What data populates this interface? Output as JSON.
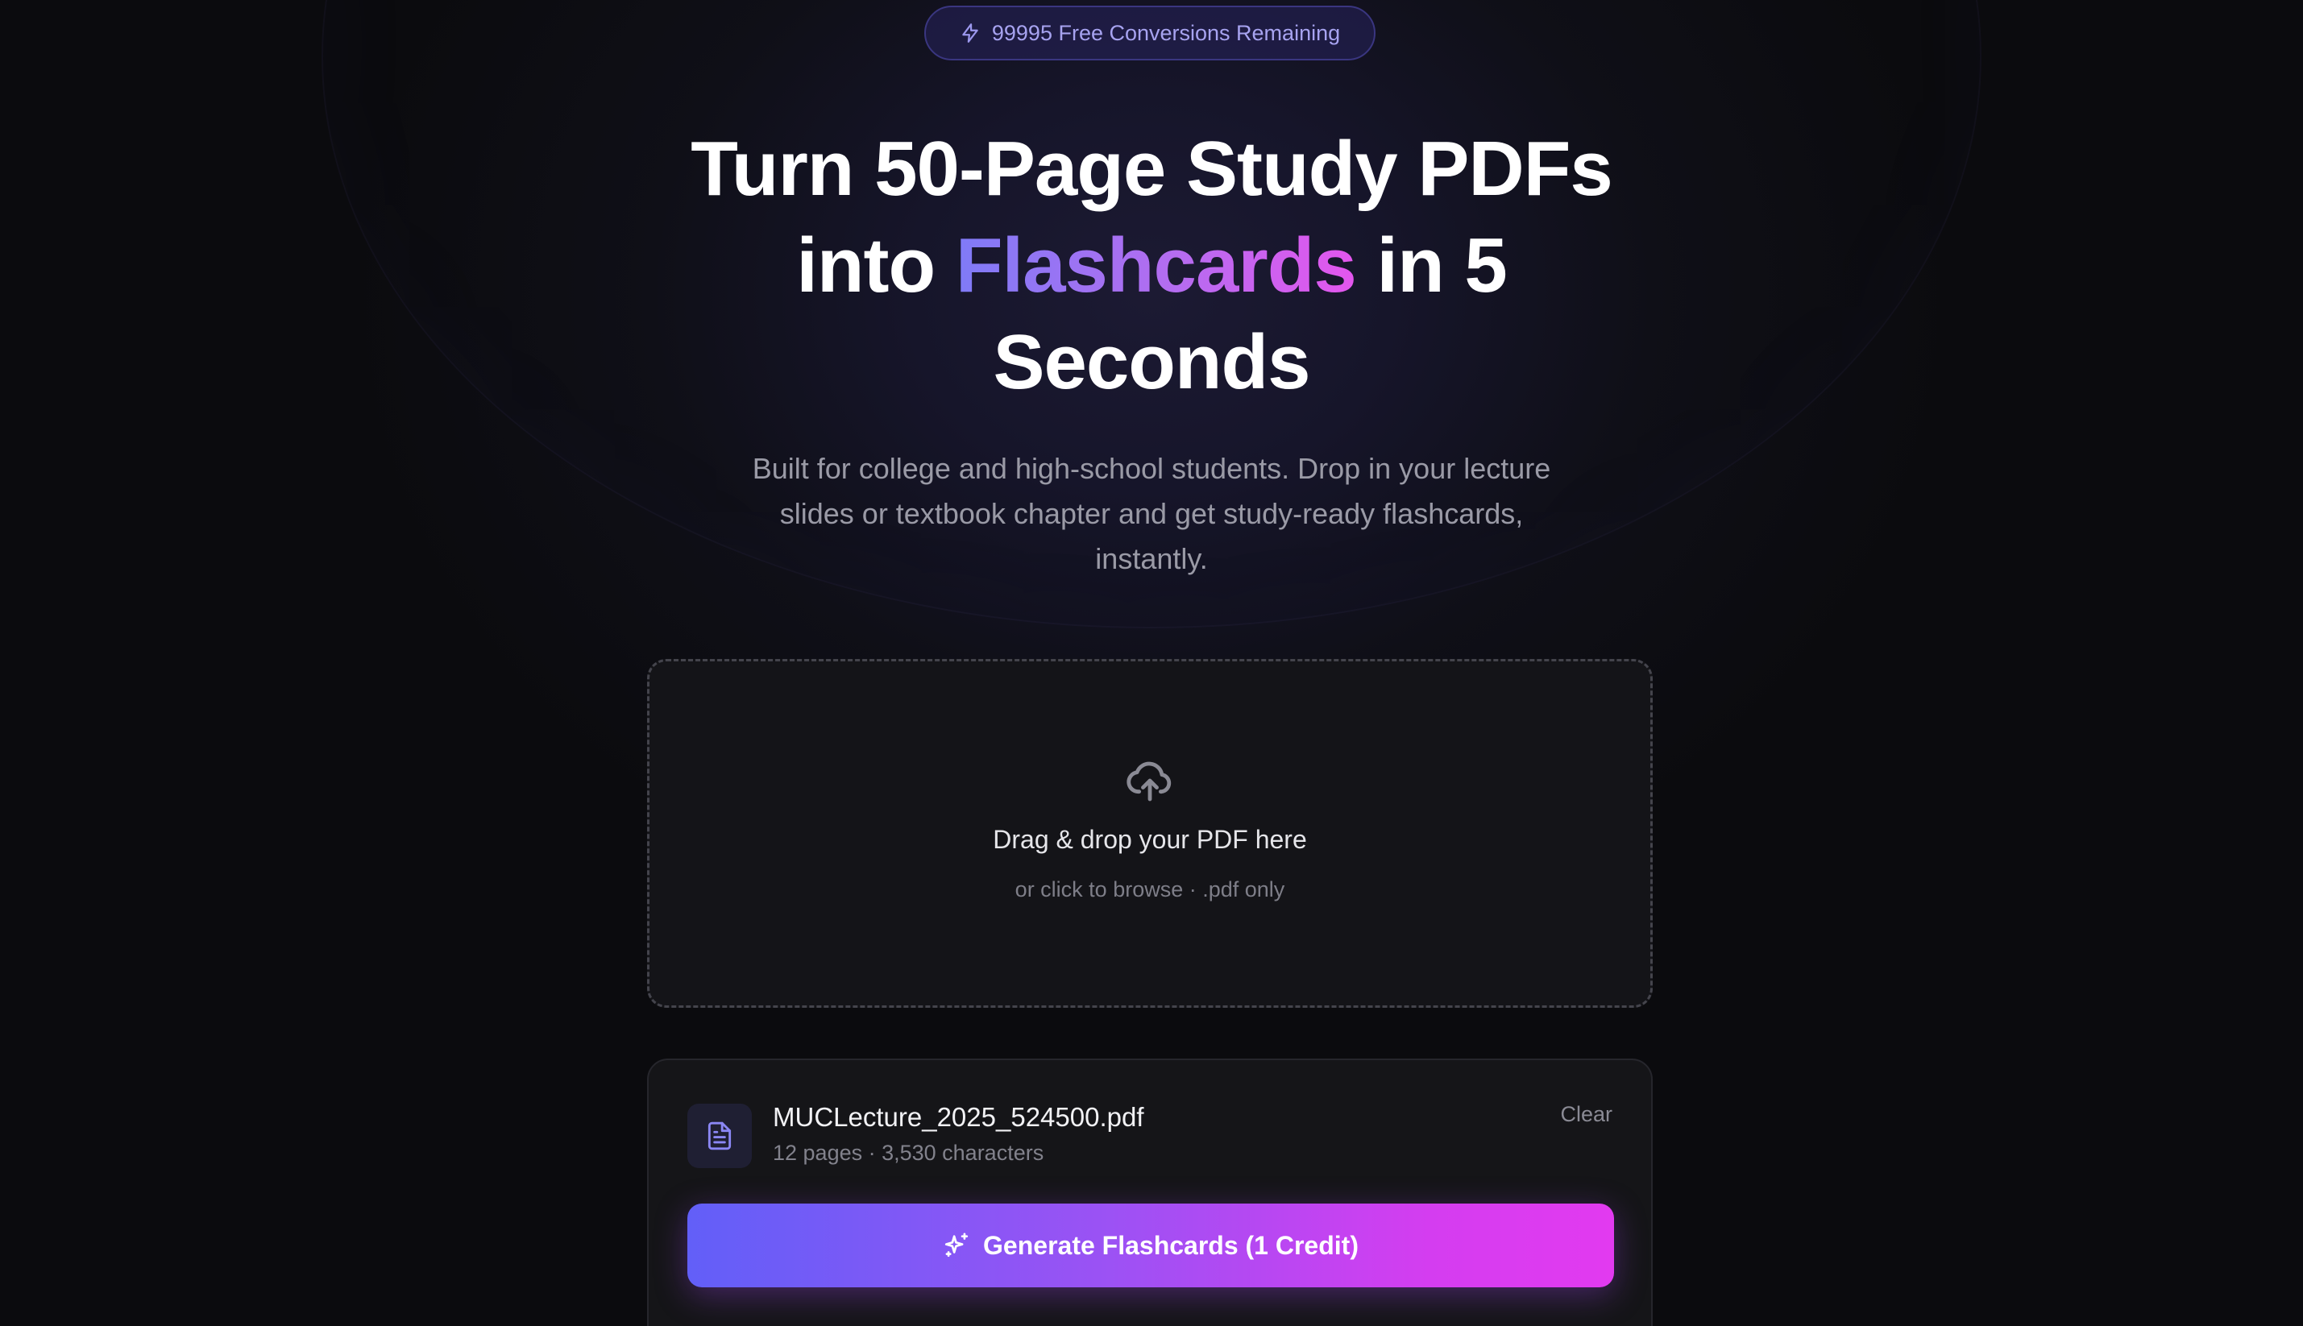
{
  "credits_badge": {
    "icon": "lightning-icon",
    "text": "99995 Free Conversions Remaining"
  },
  "hero": {
    "line1": "Turn 50-Page Study PDFs",
    "line2_prefix": "into ",
    "line2_highlight": "Flashcards",
    "line2_suffix": " in 5",
    "line3": "Seconds",
    "subtitle": "Built for college and high-school students. Drop in your lecture slides or textbook chapter and get study-ready flashcards, instantly."
  },
  "dropzone": {
    "icon": "cloud-upload-icon",
    "title": "Drag & drop your PDF here",
    "hint": "or click to browse · .pdf only"
  },
  "file": {
    "icon": "document-icon",
    "name": "MUCLecture_2025_524500.pdf",
    "meta": "12 pages · 3,530 characters",
    "clear_label": "Clear"
  },
  "generate_button": {
    "icon": "sparkles-icon",
    "label": "Generate Flashcards (1 Credit)"
  },
  "colors": {
    "accent_start": "#625ff8",
    "accent_end": "#e23af0",
    "background": "#0b0b0e"
  }
}
